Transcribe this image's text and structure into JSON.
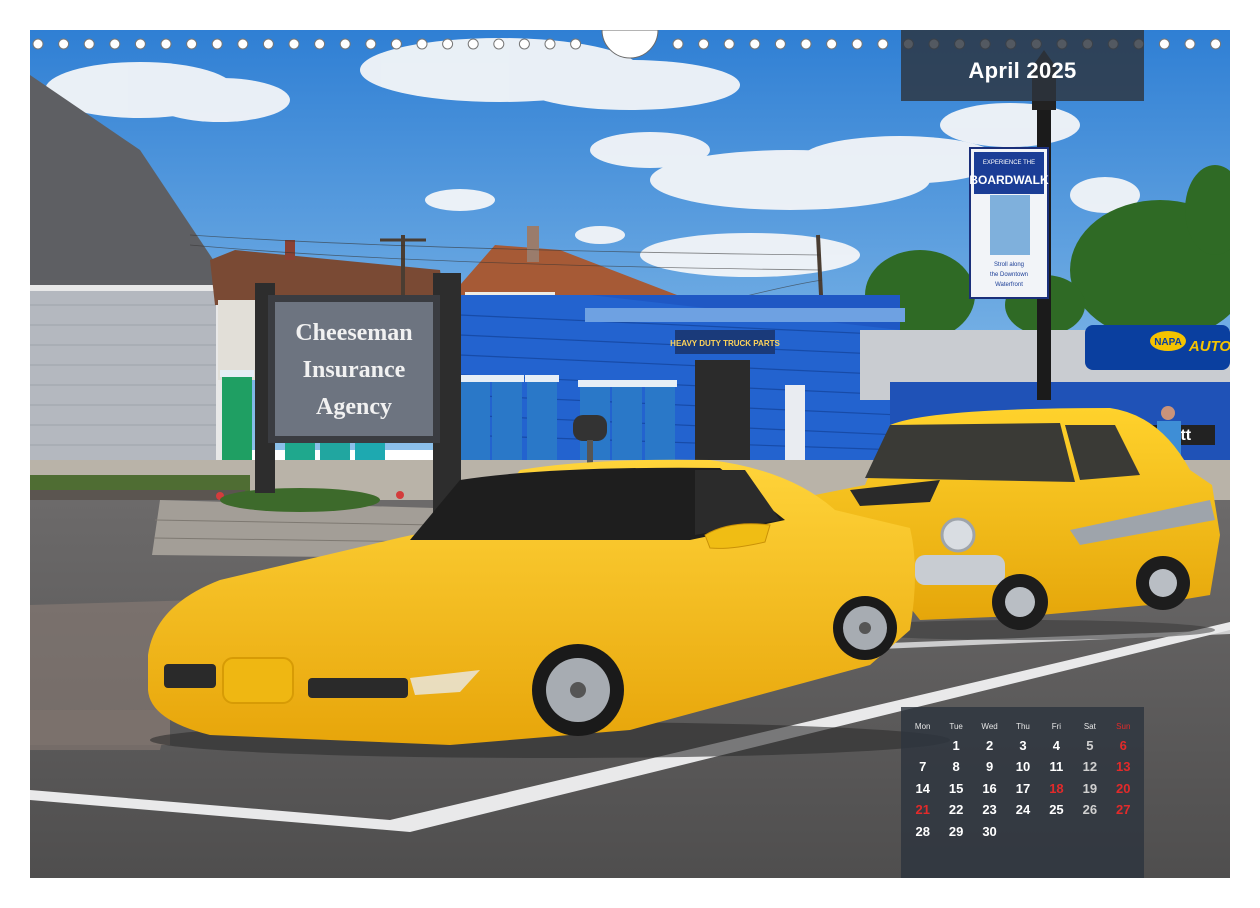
{
  "calendar": {
    "month_title": "April 2025",
    "weekdays": [
      "Mon",
      "Tue",
      "Wed",
      "Thu",
      "Fri",
      "Sat",
      "Sun"
    ],
    "weeks": [
      [
        "",
        "1",
        "2",
        "3",
        "4",
        "5",
        "6"
      ],
      [
        "7",
        "8",
        "9",
        "10",
        "11",
        "12",
        "13"
      ],
      [
        "14",
        "15",
        "16",
        "17",
        "18",
        "19",
        "20"
      ],
      [
        "21",
        "22",
        "23",
        "24",
        "25",
        "26",
        "27"
      ],
      [
        "28",
        "29",
        "30",
        "",
        "",
        "",
        ""
      ]
    ],
    "holidays": [
      "18",
      "21"
    ]
  },
  "photo": {
    "sign": {
      "line1": "Cheeseman",
      "line2": "Insurance",
      "line3": "Agency"
    },
    "store_sign": "HEAVY DUTY  TRUCK PARTS",
    "banner": {
      "line1": "EXPERIENCE THE",
      "line2": "BOARDWALK",
      "line3": "Stroll along",
      "line4": "the Downtown",
      "line5": "Waterfront"
    },
    "napa_logo": "NAPA",
    "napa_text": "AUTO",
    "carhartt": "Carhartt"
  },
  "colors": {
    "sky": "#3f88d2",
    "car_yellow": "#f6c017",
    "building_blue": "#1f58c4",
    "panel": "#2d343e",
    "sunday_red": "#e32a2a"
  }
}
